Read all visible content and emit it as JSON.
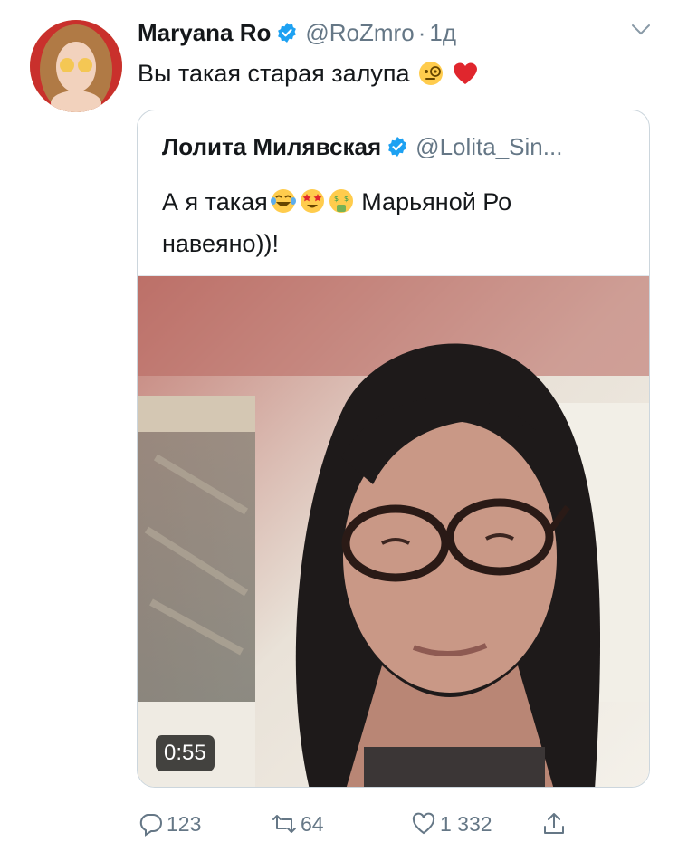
{
  "tweet": {
    "author_name": "Maryana Ro",
    "handle": "@RoZmro",
    "separator": "·",
    "time": "1д",
    "text": "Вы такая старая залупа",
    "text_emojis": [
      "monocle-face-emoji",
      "red-heart-emoji"
    ]
  },
  "quote": {
    "author_name": "Лолита Милявская",
    "handle": "@Lolita_Sin...",
    "text_part1": "А я такая",
    "text_emojis": [
      "tears-of-joy-emoji",
      "star-struck-emoji",
      "money-mouth-emoji"
    ],
    "text_part2": " Марьяной Ро навеяно))!",
    "video_duration": "0:55"
  },
  "actions": {
    "replies": "123",
    "retweets": "64",
    "likes": "1 332"
  },
  "colors": {
    "text": "#14171a",
    "secondary": "#657786",
    "verified": "#1da1f2",
    "border": "#ccd6dd"
  }
}
